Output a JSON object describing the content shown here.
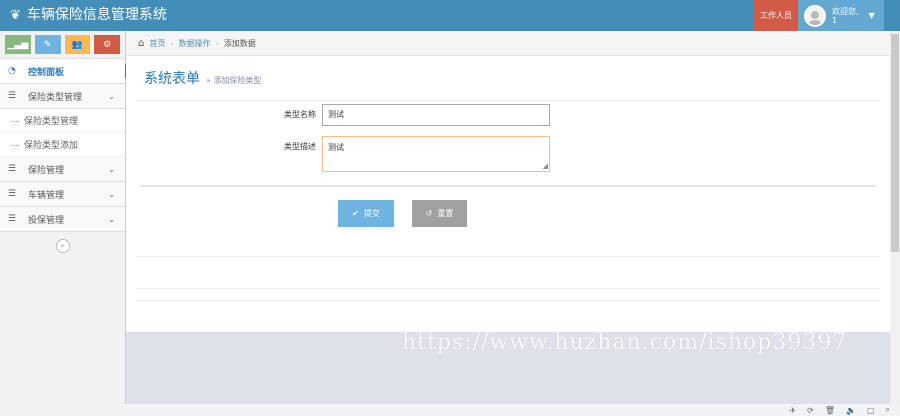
{
  "app": {
    "title": "车辆保险信息管理系统"
  },
  "header": {
    "role_label": "工作人员",
    "welcome": "欢迎您,",
    "username": "1"
  },
  "shortcuts": [
    "stats",
    "edit",
    "users",
    "settings"
  ],
  "sidebar": {
    "items": [
      {
        "label": "控制面板",
        "icon": "dashboard-icon",
        "active": true
      },
      {
        "label": "保险类型管理",
        "icon": "list-icon",
        "expanded": true,
        "children": [
          {
            "label": "保险类型管理"
          },
          {
            "label": "保险类型添加"
          }
        ]
      },
      {
        "label": "保险管理",
        "icon": "list-icon"
      },
      {
        "label": "车辆管理",
        "icon": "list-icon"
      },
      {
        "label": "投保管理",
        "icon": "list-icon"
      }
    ]
  },
  "breadcrumb": [
    "首页",
    "数据操作",
    "添加数据"
  ],
  "page": {
    "title": "系统表单",
    "subtitle": "» 添加保险类型"
  },
  "form": {
    "name_label": "类型名称",
    "name_value": "测试",
    "desc_label": "类型描述",
    "desc_value": "测试",
    "submit_label": "提交",
    "reset_label": "重置"
  },
  "watermark": "https://www.huzhan.com/ishop39397",
  "colors": {
    "navbar": "#438eb9",
    "role": "#d15b47",
    "submit": "#6fb3e0",
    "reset": "#a0a0a0",
    "title": "#2679b5"
  }
}
